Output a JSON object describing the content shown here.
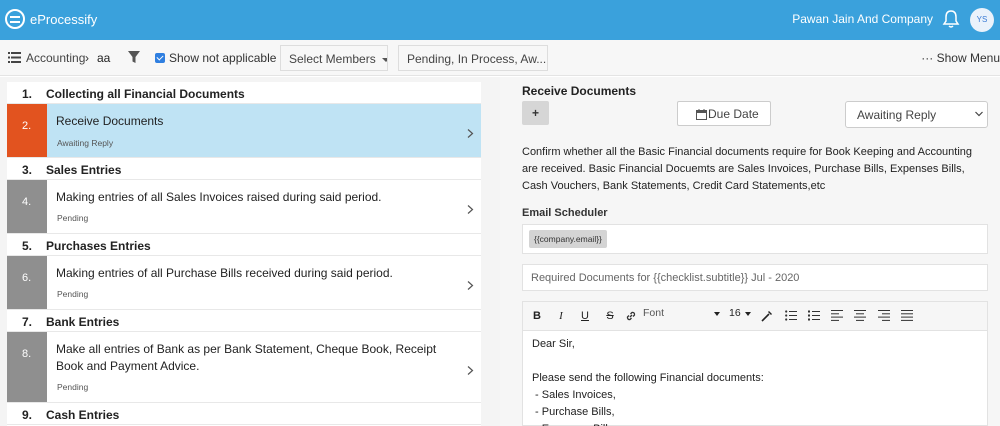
{
  "app": {
    "brand": "eProcessify",
    "company": "Pawan Jain And Company",
    "avatar_initials": "YS",
    "accent_color": "#3aa1dc"
  },
  "toolbar": {
    "breadcrumb": [
      "Accounting",
      "aa"
    ],
    "breadcrumb_sep": "›",
    "show_not_applicable_label": "Show not applicable",
    "show_not_applicable_checked": true,
    "members_dropdown": "Select Members",
    "status_dropdown": "Pending, In Process, Aw...",
    "show_menu_label": "··· Show Menu"
  },
  "checklist": [
    {
      "kind": "heading",
      "num": "1.",
      "title": "Collecting all Financial Documents"
    },
    {
      "kind": "task",
      "num": "2.",
      "title": "Receive Documents",
      "status": "Awaiting Reply",
      "active": true,
      "color": "#e2531f"
    },
    {
      "kind": "heading",
      "num": "3.",
      "title": "Sales Entries"
    },
    {
      "kind": "task",
      "num": "4.",
      "title": "Making entries of all Sales Invoices raised during said period.",
      "status": "Pending",
      "active": false,
      "color": "#8f8f8f"
    },
    {
      "kind": "heading",
      "num": "5.",
      "title": "Purchases Entries"
    },
    {
      "kind": "task",
      "num": "6.",
      "title": "Making entries of all Purchase Bills received during said period.",
      "status": "Pending",
      "active": false,
      "color": "#8f8f8f"
    },
    {
      "kind": "heading",
      "num": "7.",
      "title": "Bank Entries"
    },
    {
      "kind": "task",
      "num": "8.",
      "title": "Make all entries of Bank as per Bank Statement, Cheque Book, Receipt Book and Payment Advice.",
      "status": "Pending",
      "active": false,
      "color": "#8f8f8f"
    },
    {
      "kind": "heading",
      "num": "9.",
      "title": "Cash Entries"
    }
  ],
  "detail": {
    "title": "Receive Documents",
    "plus_label": "+",
    "due_date_label": "Due Date",
    "status_select": "Awaiting Reply",
    "description": "Confirm whether all the Basic Financial documents require for Book Keeping and Accounting are received. Basic Financial Docuemts are Sales Invoices, Purchase Bills, Expenses Bills, Cash Vouchers, Bank Statements, Credit Card Statements,etc",
    "email_scheduler_label": "Email Scheduler",
    "email_chip": "{{company.email}}",
    "subject_placeholder": "Required Documents for {{checklist.subtitle}} Jul - 2020",
    "editor": {
      "font_label": "Font",
      "size_label": "16",
      "buttons": [
        "B",
        "I",
        "U",
        "S"
      ],
      "body": "Dear Sir,\n\nPlease send the following Financial documents:\n - Sales Invoices,\n - Purchase Bills,\n - Expenses Bills,"
    }
  }
}
